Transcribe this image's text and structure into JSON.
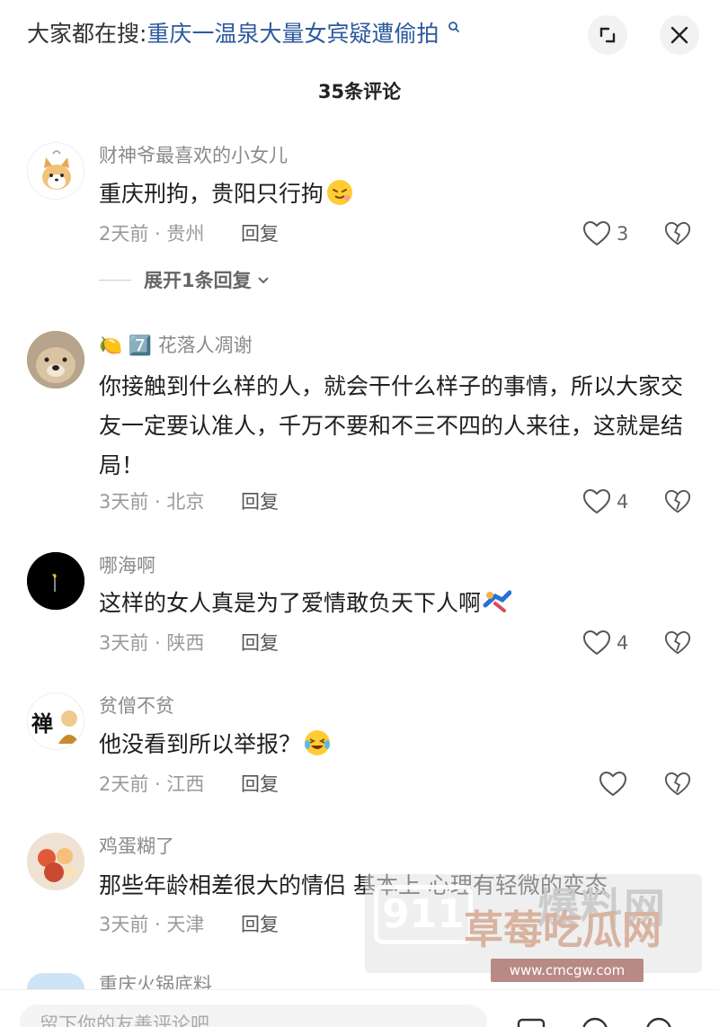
{
  "top": {
    "prefix": "大家都在搜",
    "colon": ":",
    "query": "重庆一温泉大量女宾疑遭偷拍"
  },
  "comment_count": "35条评论",
  "comments": [
    {
      "username": "财神爷最喜欢的小女儿",
      "text": "重庆刑拘，贵阳只行拘",
      "emoji": "sleepy-face-emoji",
      "time_location": "2天前 · 贵州",
      "reply_label": "回复",
      "likes": "3",
      "expand_label": "展开1条回复",
      "avatar": "shiba-dog-cartoon"
    },
    {
      "badges": [
        "🍋",
        "7️⃣"
      ],
      "username": "花落人凋谢",
      "text": "你接触到什么样的人，就会干什么样子的事情，所以大家交友一定要认准人，千万不要和不三不四的人来往，这就是结局！",
      "time_location": "3天前 · 北京",
      "reply_label": "回复",
      "likes": "4",
      "avatar": "dog-photo"
    },
    {
      "username": "哪海啊",
      "text": "这样的女人真是为了爱情敢负天下人啊",
      "emoji": "flying-person-emoji",
      "time_location": "3天前 · 陕西",
      "reply_label": "回复",
      "likes": "4",
      "avatar": "dark-flag"
    },
    {
      "username": "贫僧不贫",
      "text": "他没看到所以举报？",
      "emoji": "laughing-tears-emoji",
      "time_location": "2天前 · 江西",
      "reply_label": "回复",
      "likes": "",
      "avatar": "zen-monk",
      "avatar_char": "禅"
    },
    {
      "username": "鸡蛋糊了",
      "text": "那些年龄相差很大的情侣 基本上 心理有轻微的变态",
      "time_location": "3天前 · 天津",
      "reply_label": "回复",
      "likes": "",
      "avatar": "food-photo"
    },
    {
      "username": "重庆火锅底料",
      "avatar": "sky-photo"
    }
  ],
  "bottom": {
    "placeholder": "留下你的友善评论吧"
  },
  "watermark": {
    "logo": "911",
    "site_cn": "草莓吃瓜网",
    "site_en": "爆料网",
    "url": "www.cmcgw.com"
  },
  "colors": {
    "link_blue": "#2c5a9c",
    "meta_gray": "#9a9a9a"
  }
}
